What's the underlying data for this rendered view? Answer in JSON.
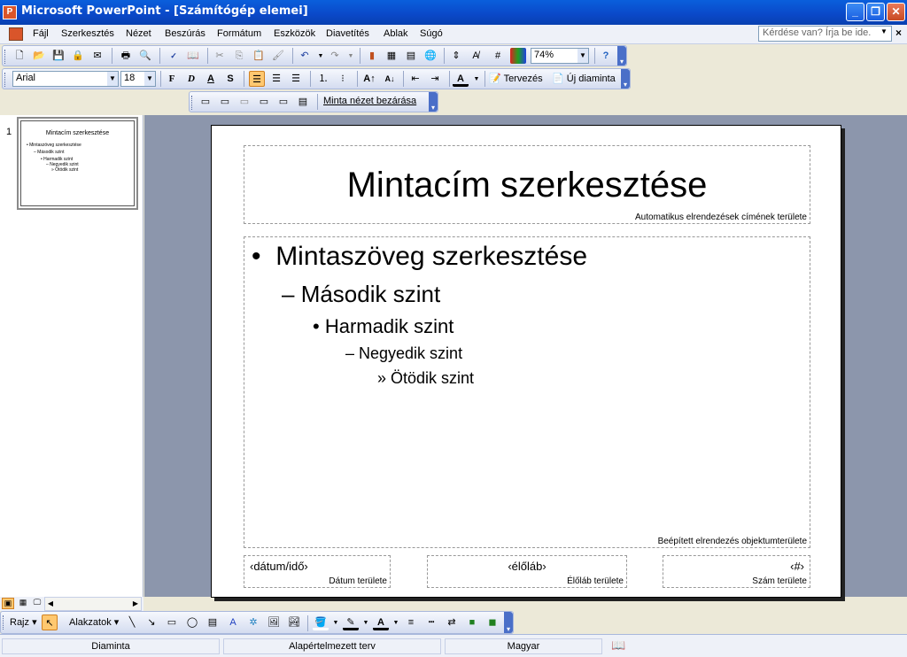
{
  "window": {
    "title": "Microsoft PowerPoint - [Számítógép elemei]"
  },
  "menu": {
    "items": [
      "Fájl",
      "Szerkesztés",
      "Nézet",
      "Beszúrás",
      "Formátum",
      "Eszközök",
      "Diavetítés",
      "Ablak",
      "Súgó"
    ],
    "help_placeholder": "Kérdése van? Írja be ide."
  },
  "standard_toolbar": {
    "zoom": "74%"
  },
  "format_toolbar": {
    "font": "Arial",
    "size": "18",
    "design_label": "Tervezés",
    "new_slide_label": "Új diaminta"
  },
  "master_toolbar": {
    "close_label": "Minta nézet bezárása"
  },
  "thumbnail": {
    "number": "1",
    "title": "Mintacím szerkesztése",
    "bullets": [
      "• Mintaszöveg szerkesztése",
      "– Második szint",
      "• Harmadik szint",
      "– Negyedik szint",
      "» Ötödik szint"
    ]
  },
  "slide": {
    "title": "Mintacím szerkesztése",
    "title_area_label": "Automatikus elrendezések címének területe",
    "level1": "Mintaszöveg szerkesztése",
    "level2": "Második szint",
    "level3": "Harmadik szint",
    "level4": "Negyedik szint",
    "level5": "Ötödik szint",
    "object_area_label": "Beépített elrendezés objektumterülete",
    "date_text": "‹dátum/idő›",
    "date_label": "Dátum területe",
    "footer_text": "‹élőláb›",
    "footer_label": "Élőláb területe",
    "number_text": "‹#›",
    "number_label": "Szám területe"
  },
  "draw_toolbar": {
    "draw_label": "Rajz",
    "shapes_label": "Alakzatok"
  },
  "status": {
    "view": "Diaminta",
    "design": "Alapértelmezett terv",
    "language": "Magyar"
  },
  "colors": {
    "titlebar": "#0a48c8",
    "workspace": "#8c96ac"
  }
}
